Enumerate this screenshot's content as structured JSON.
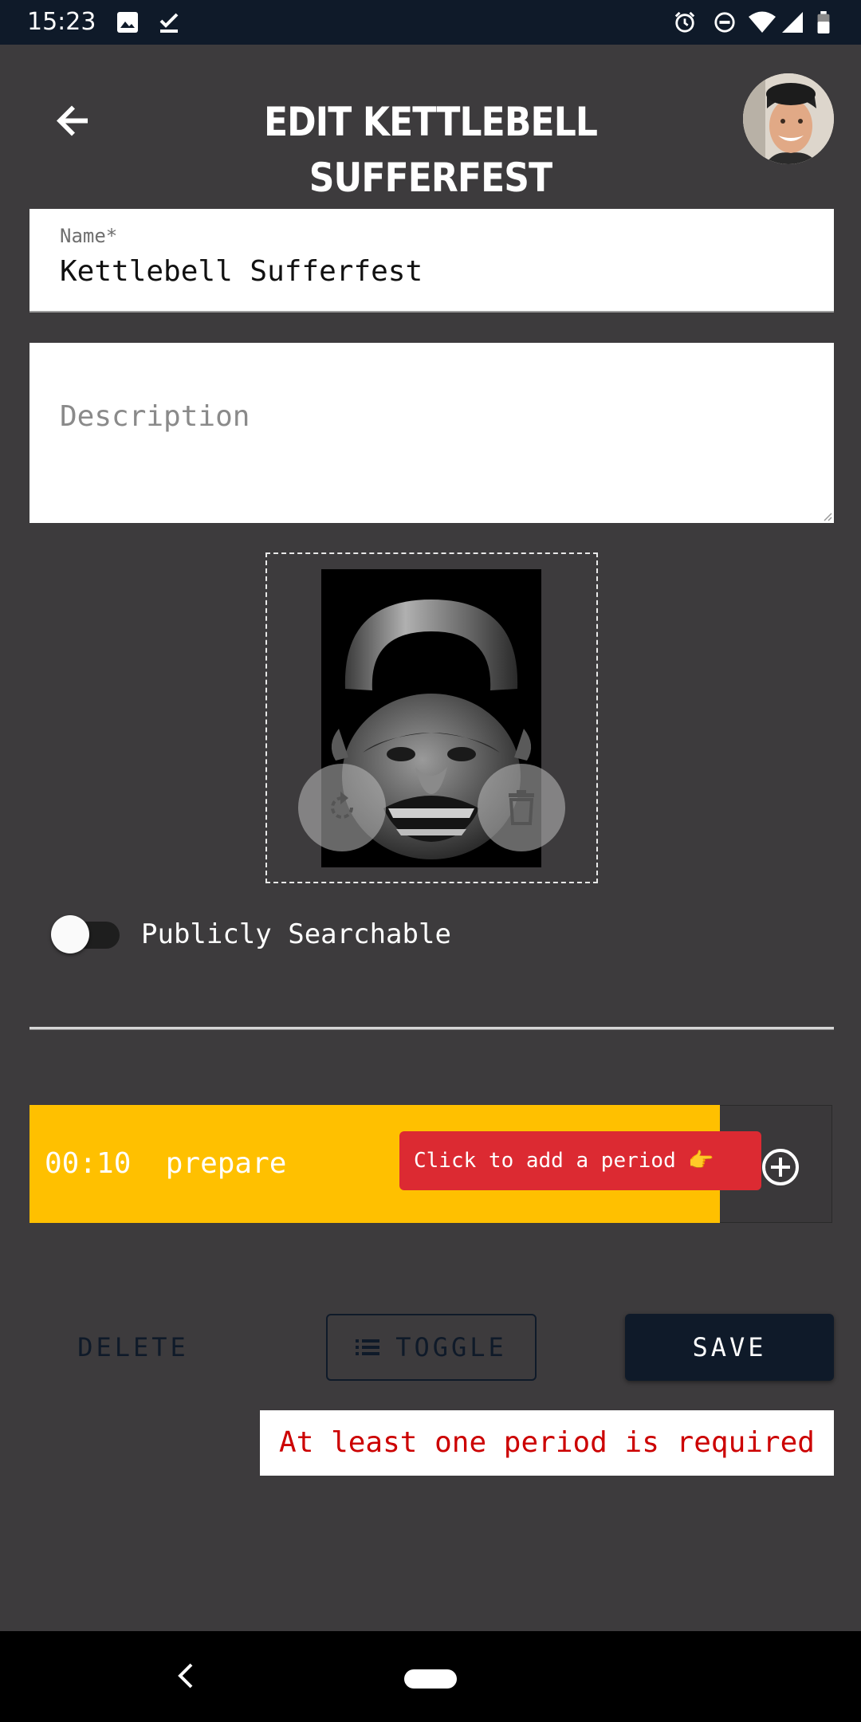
{
  "status_bar": {
    "time": "15:23",
    "left_icons": [
      "image-icon",
      "check-download-icon"
    ],
    "right_icons": [
      "alarm-icon",
      "do-not-disturb-icon",
      "wifi-icon",
      "signal-icon",
      "battery-icon"
    ]
  },
  "header": {
    "title": "EDIT KETTLEBELL SUFFERFEST"
  },
  "form": {
    "name_label": "Name*",
    "name_value": "Kettlebell Sufferfest",
    "description_placeholder": "Description"
  },
  "visibility": {
    "label": "Publicly Searchable",
    "on": false
  },
  "periods": {
    "items": [
      {
        "time": "00:10",
        "name": "prepare"
      }
    ],
    "tooltip": "Click to add a period 👉"
  },
  "actions": {
    "delete_label": "DELETE",
    "toggle_label": "TOGGLE",
    "save_label": "SAVE"
  },
  "error": "At least one period is required",
  "colors": {
    "background": "#3d3b3d",
    "navy": "#0f1a29",
    "period_yellow": "#ffc000",
    "tooltip_red": "#dc2a32",
    "error_red": "#cc0000"
  }
}
